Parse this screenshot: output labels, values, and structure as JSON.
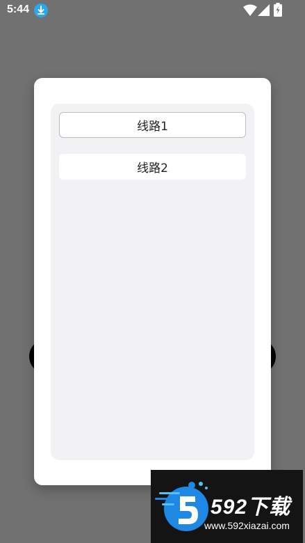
{
  "status_bar": {
    "time": "5:44",
    "icons": [
      "download-icon",
      "wifi-icon",
      "signal-icon",
      "battery-icon"
    ]
  },
  "dialog": {
    "routes": [
      {
        "label": "线路1",
        "selected": true
      },
      {
        "label": "线路2",
        "selected": false
      }
    ]
  },
  "watermark": {
    "brand": "592下载",
    "url": "www.592xiazai.com"
  },
  "colors": {
    "overlay": "#717171",
    "dialog_bg": "#ffffff",
    "panel_bg": "#f2f2f4",
    "accent_blue": "#1e88e5",
    "download_badge": "#29a8f0"
  }
}
